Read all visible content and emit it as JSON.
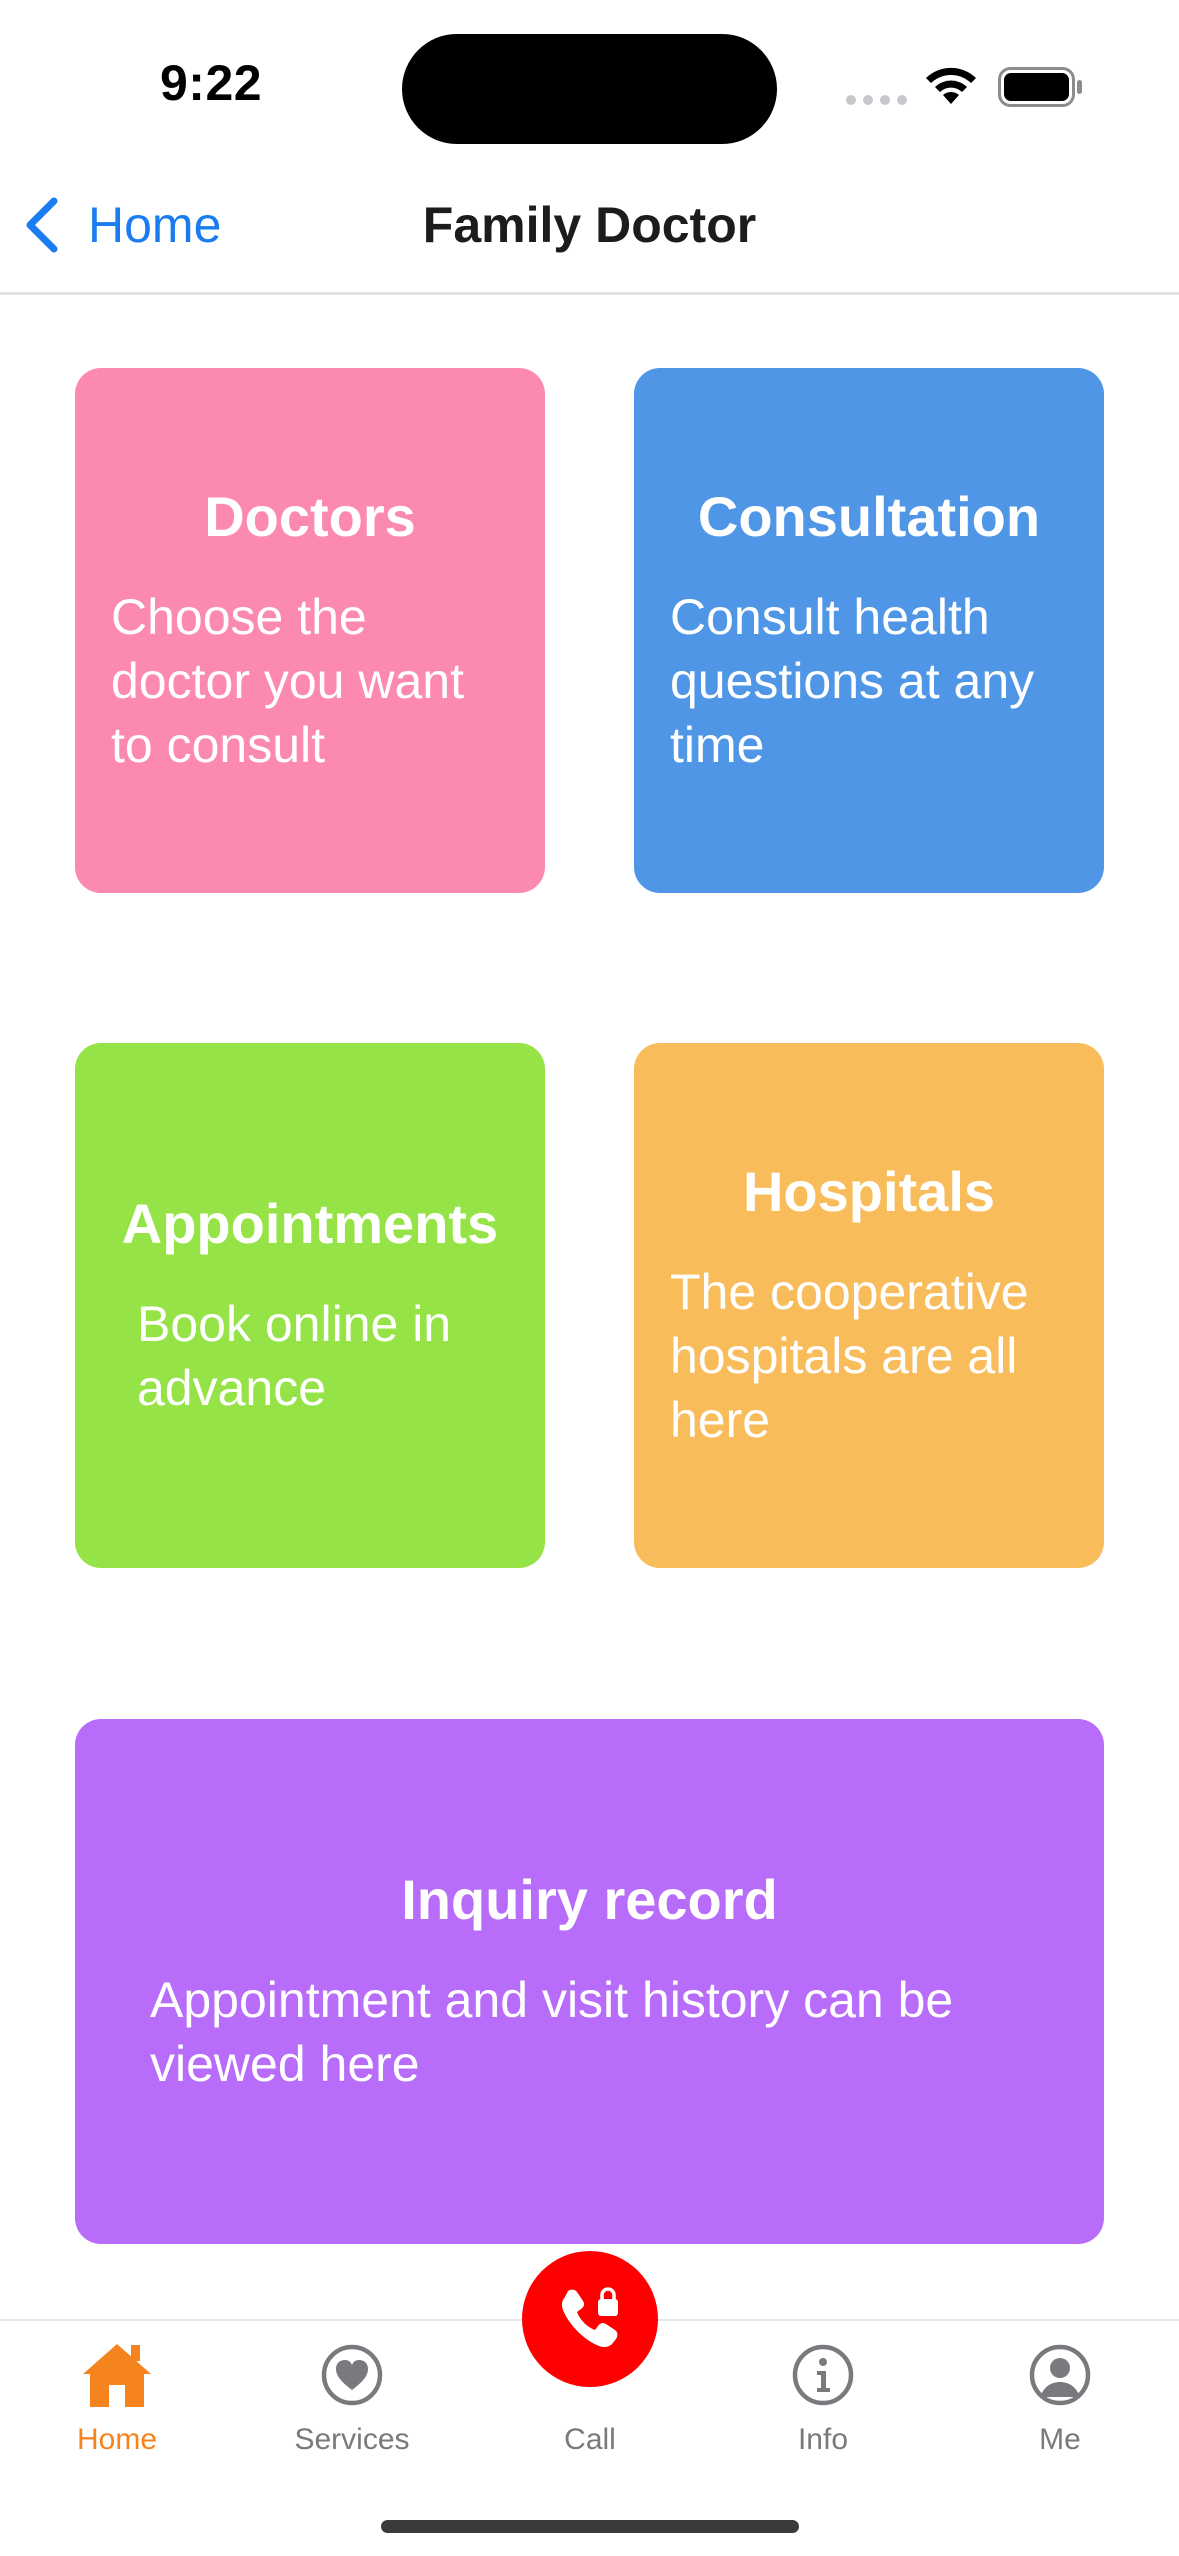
{
  "status_bar": {
    "time": "9:22"
  },
  "nav": {
    "back_label": "Home",
    "title": "Family Doctor"
  },
  "cards": [
    {
      "title": "Doctors",
      "description": "Choose the doctor you want to consult",
      "color": "#fc8aae"
    },
    {
      "title": "Consultation",
      "description": "Consult health questions at any time",
      "color": "#5096e6"
    },
    {
      "title": "Appointments",
      "description": "Book online in advance",
      "color": "#95e346"
    },
    {
      "title": "Hospitals",
      "description": "The cooperative hospitals are all here",
      "color": "#f8bc5a"
    },
    {
      "title": "Inquiry record",
      "description": "Appointment and visit history can be viewed here",
      "color": "#b86cfa"
    }
  ],
  "tab_bar": {
    "active_color": "#f5841f",
    "inactive_color": "#7a7a7e",
    "items": [
      {
        "label": "Home",
        "icon": "house-icon",
        "active": true
      },
      {
        "label": "Services",
        "icon": "heart-circle-icon",
        "active": false
      },
      {
        "label": "Call",
        "icon": "phone-lock-icon",
        "active": false
      },
      {
        "label": "Info",
        "icon": "info-circle-icon",
        "active": false
      },
      {
        "label": "Me",
        "icon": "person-circle-icon",
        "active": false
      }
    ]
  }
}
